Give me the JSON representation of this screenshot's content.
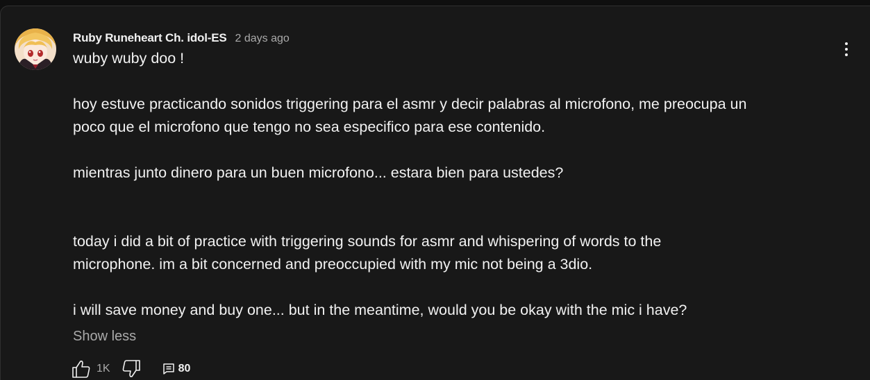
{
  "comment": {
    "author": "Ruby Runeheart Ch. idol-ES",
    "timestamp": "2 days ago",
    "lines": [
      "wuby wuby doo !",
      "hoy estuve practicando sonidos triggering para el asmr y decir palabras al microfono, me preocupa un",
      "poco que el microfono que tengo no sea especifico para ese contenido.",
      "mientras junto dinero para un buen microfono... estara bien para ustedes?",
      "today i did a bit of practice with triggering sounds for asmr and whispering of words to the",
      "microphone. im a bit concerned and preoccupied with my mic not being a 3dio.",
      "i will save money and buy one... but in the meantime, would you be okay with the mic i have?"
    ],
    "show_less_label": "Show less",
    "like_count": "1K",
    "reply_count": "80"
  },
  "icons": {
    "avatar": "avatar-image",
    "menu": "more-vert-icon",
    "like": "thumbs-up-icon",
    "dislike": "thumbs-down-icon",
    "replies": "comment-icon"
  },
  "colors": {
    "background": "#0f0f0f",
    "card": "#181818",
    "text_primary": "#f1f1f1",
    "text_secondary": "#aaaaaa"
  }
}
